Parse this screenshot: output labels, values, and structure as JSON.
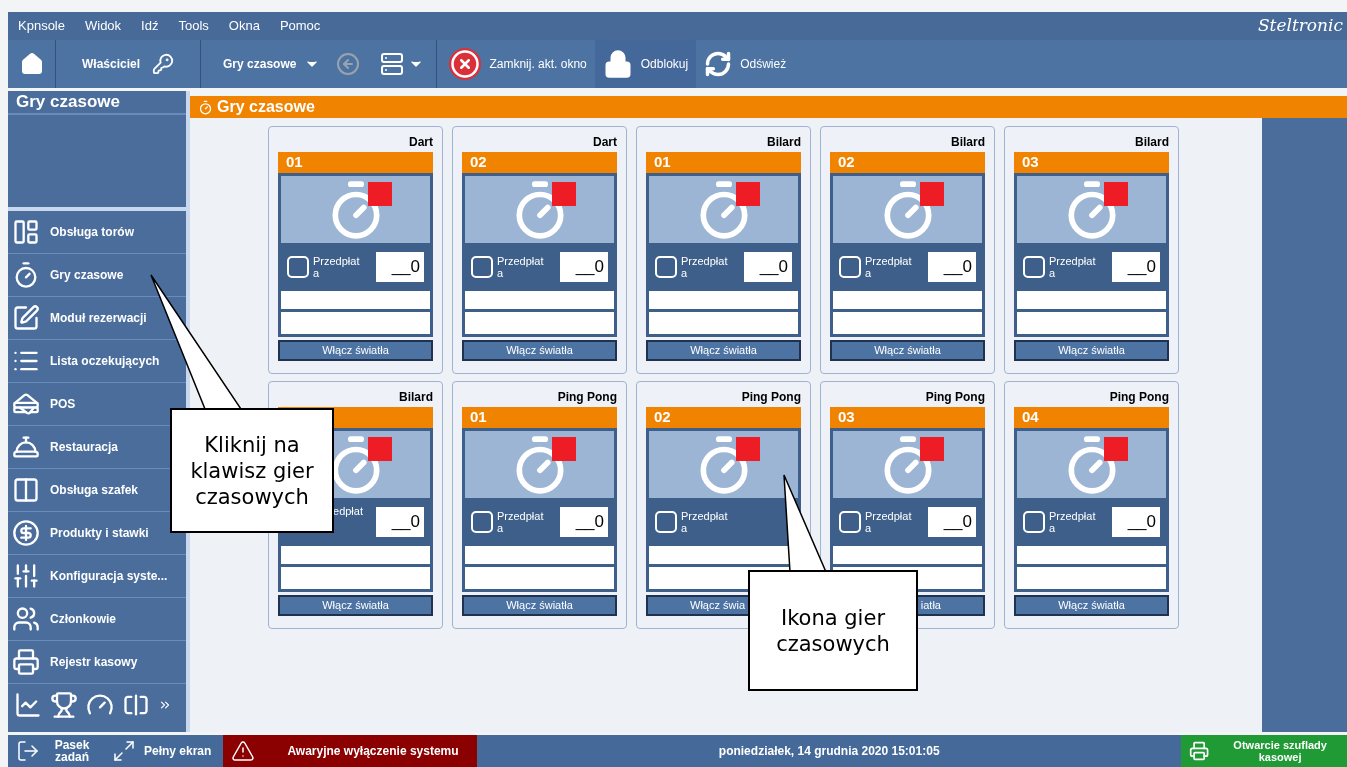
{
  "menu": [
    "Kpnsole",
    "Widok",
    "Idź",
    "Tools",
    "Okna",
    "Pomoc"
  ],
  "logo": "Steltronic",
  "toolbar": {
    "user": "Właściciel",
    "module": "Gry czasowe",
    "close": "Zamknij. akt. okno",
    "unlock": "Odblokuj",
    "refresh": "Odśwież"
  },
  "sidebar": {
    "title": "Gry czasowe",
    "items": [
      {
        "label": "Obsługa torów"
      },
      {
        "label": "Gry czasowe"
      },
      {
        "label": "Moduł rezerwacji"
      },
      {
        "label": "Lista oczekujących"
      },
      {
        "label": "POS"
      },
      {
        "label": "Restauracja"
      },
      {
        "label": "Obsługa szafek"
      },
      {
        "label": "Produkty i stawki"
      },
      {
        "label": "Konfiguracja syste..."
      },
      {
        "label": "Członkowie"
      },
      {
        "label": "Rejestr kasowy"
      }
    ]
  },
  "panel": {
    "title": "Gry czasowe"
  },
  "cards": [
    {
      "kind": "normal",
      "game": "Dart",
      "number": "01",
      "checked": false,
      "prepaid_label": "Przedpłata",
      "value": "__0",
      "button": {
        "kind": "full",
        "label": "Włącz światła"
      },
      "color": "#ee1c25"
    },
    {
      "kind": "normal",
      "game": "Dart",
      "number": "02",
      "checked": false,
      "prepaid_label": "Przedpłata",
      "value": "__0",
      "button": {
        "kind": "full",
        "label": "Włącz światła"
      },
      "color": "#ee1c25"
    },
    {
      "kind": "normal",
      "game": "Bilard",
      "number": "01",
      "checked": false,
      "prepaid_label": "Przedpłata",
      "value": "__0",
      "button": {
        "kind": "full",
        "label": "Włącz światła"
      },
      "color": "#ee1c25"
    },
    {
      "kind": "normal",
      "game": "Bilard",
      "number": "02",
      "checked": false,
      "prepaid_label": "Przedpłata",
      "value": "__0",
      "button": {
        "kind": "full",
        "label": "Włącz światła"
      },
      "color": "#ee1c25"
    },
    {
      "kind": "normal",
      "game": "Bilard",
      "number": "03",
      "checked": false,
      "prepaid_label": "Przedpłata",
      "value": "__0",
      "button": {
        "kind": "full",
        "label": "Włącz światła"
      },
      "color": "#ee1c25"
    },
    {
      "kind": "covered",
      "game": "Bilard",
      "prepaid_label": "edpłat",
      "value": "__0",
      "button": {
        "kind": "full",
        "label": "Włącz światła"
      },
      "color": "#ee1c25"
    },
    {
      "kind": "normal",
      "game": "Ping Pong",
      "number": "01",
      "checked": false,
      "prepaid_label": "Przedpłata",
      "value": "__0",
      "button": {
        "kind": "full",
        "label": "Włącz światła"
      },
      "color": "#ee1c25"
    },
    {
      "kind": "normal",
      "game": "Ping Pong",
      "number": "02",
      "checked": false,
      "prepaid_label": "Przedpłata",
      "button": {
        "kind": "leading",
        "label": "Włącz świa"
      },
      "color": "#ee1c25"
    },
    {
      "kind": "normal",
      "game": "Ping Pong",
      "number": "03",
      "checked": false,
      "prepaid_label": "Przedpłata",
      "value": "__0",
      "button": {
        "kind": "trailing",
        "label": "iatła"
      },
      "color": "#ee1c25"
    },
    {
      "kind": "normal",
      "game": "Ping Pong",
      "number": "04",
      "checked": false,
      "prepaid_label": "Przedpłata",
      "value": "__0",
      "button": {
        "kind": "full",
        "label": "Włącz światła"
      },
      "color": "#ee1c25"
    }
  ],
  "callouts": [
    {
      "text": "Kliknij na klawisz gier czasowych"
    },
    {
      "text": "Ikona gier czasowych"
    }
  ],
  "status_bar": {
    "taskbar": "Pasek zadań",
    "fullscreen": "Pełny ekran",
    "emergency": "Awaryjne wyłączenie systemu",
    "datetime": "poniedziałek, 14 grudnia 2020 15:01:05",
    "drawer": "Otwarcie szuflady kasowej"
  }
}
